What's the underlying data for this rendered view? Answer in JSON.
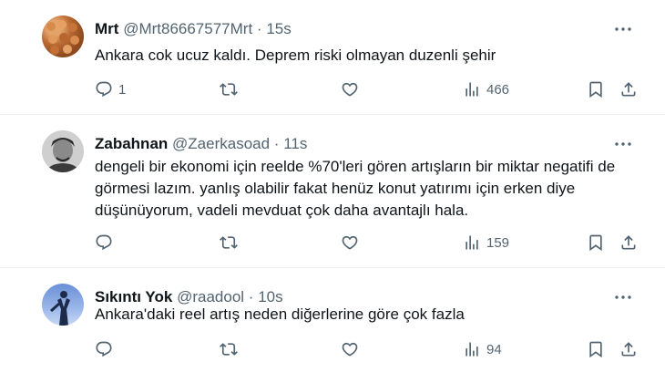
{
  "tweets": [
    {
      "name": "Mrt",
      "handle": "@Mrt86667577Mrt",
      "dot": "·",
      "time": "15s",
      "text": "Ankara cok ucuz kaldı. Deprem riski olmayan duzenli şehir",
      "replies": "1",
      "retweets": "",
      "likes": "",
      "views": "466"
    },
    {
      "name": "Zabahnan",
      "handle": "@Zaerkasoad",
      "dot": "·",
      "time": "11s",
      "text": "dengeli bir ekonomi için reelde %70'leri gören artışların bir miktar negatifi de görmesi lazım. yanlış olabilir fakat henüz konut yatırımı için erken diye düşünüyorum, vadeli mevduat çok daha avantajlı hala.",
      "replies": "",
      "retweets": "",
      "likes": "",
      "views": "159"
    },
    {
      "name": "Sıkıntı Yok",
      "handle": "@raadool",
      "dot": "·",
      "time": "10s",
      "text": "Ankara'daki reel artış neden diğerlerine göre çok fazla",
      "replies": "",
      "retweets": "",
      "likes": "",
      "views": "94"
    }
  ],
  "icons": {
    "more": "more-icon",
    "reply": "reply-icon",
    "retweet": "retweet-icon",
    "like": "like-icon",
    "views": "views-icon",
    "bookmark": "bookmark-icon",
    "share": "share-icon"
  },
  "colors": {
    "text": "#0f1419",
    "secondary": "#536471",
    "divider": "#eff3f4"
  }
}
